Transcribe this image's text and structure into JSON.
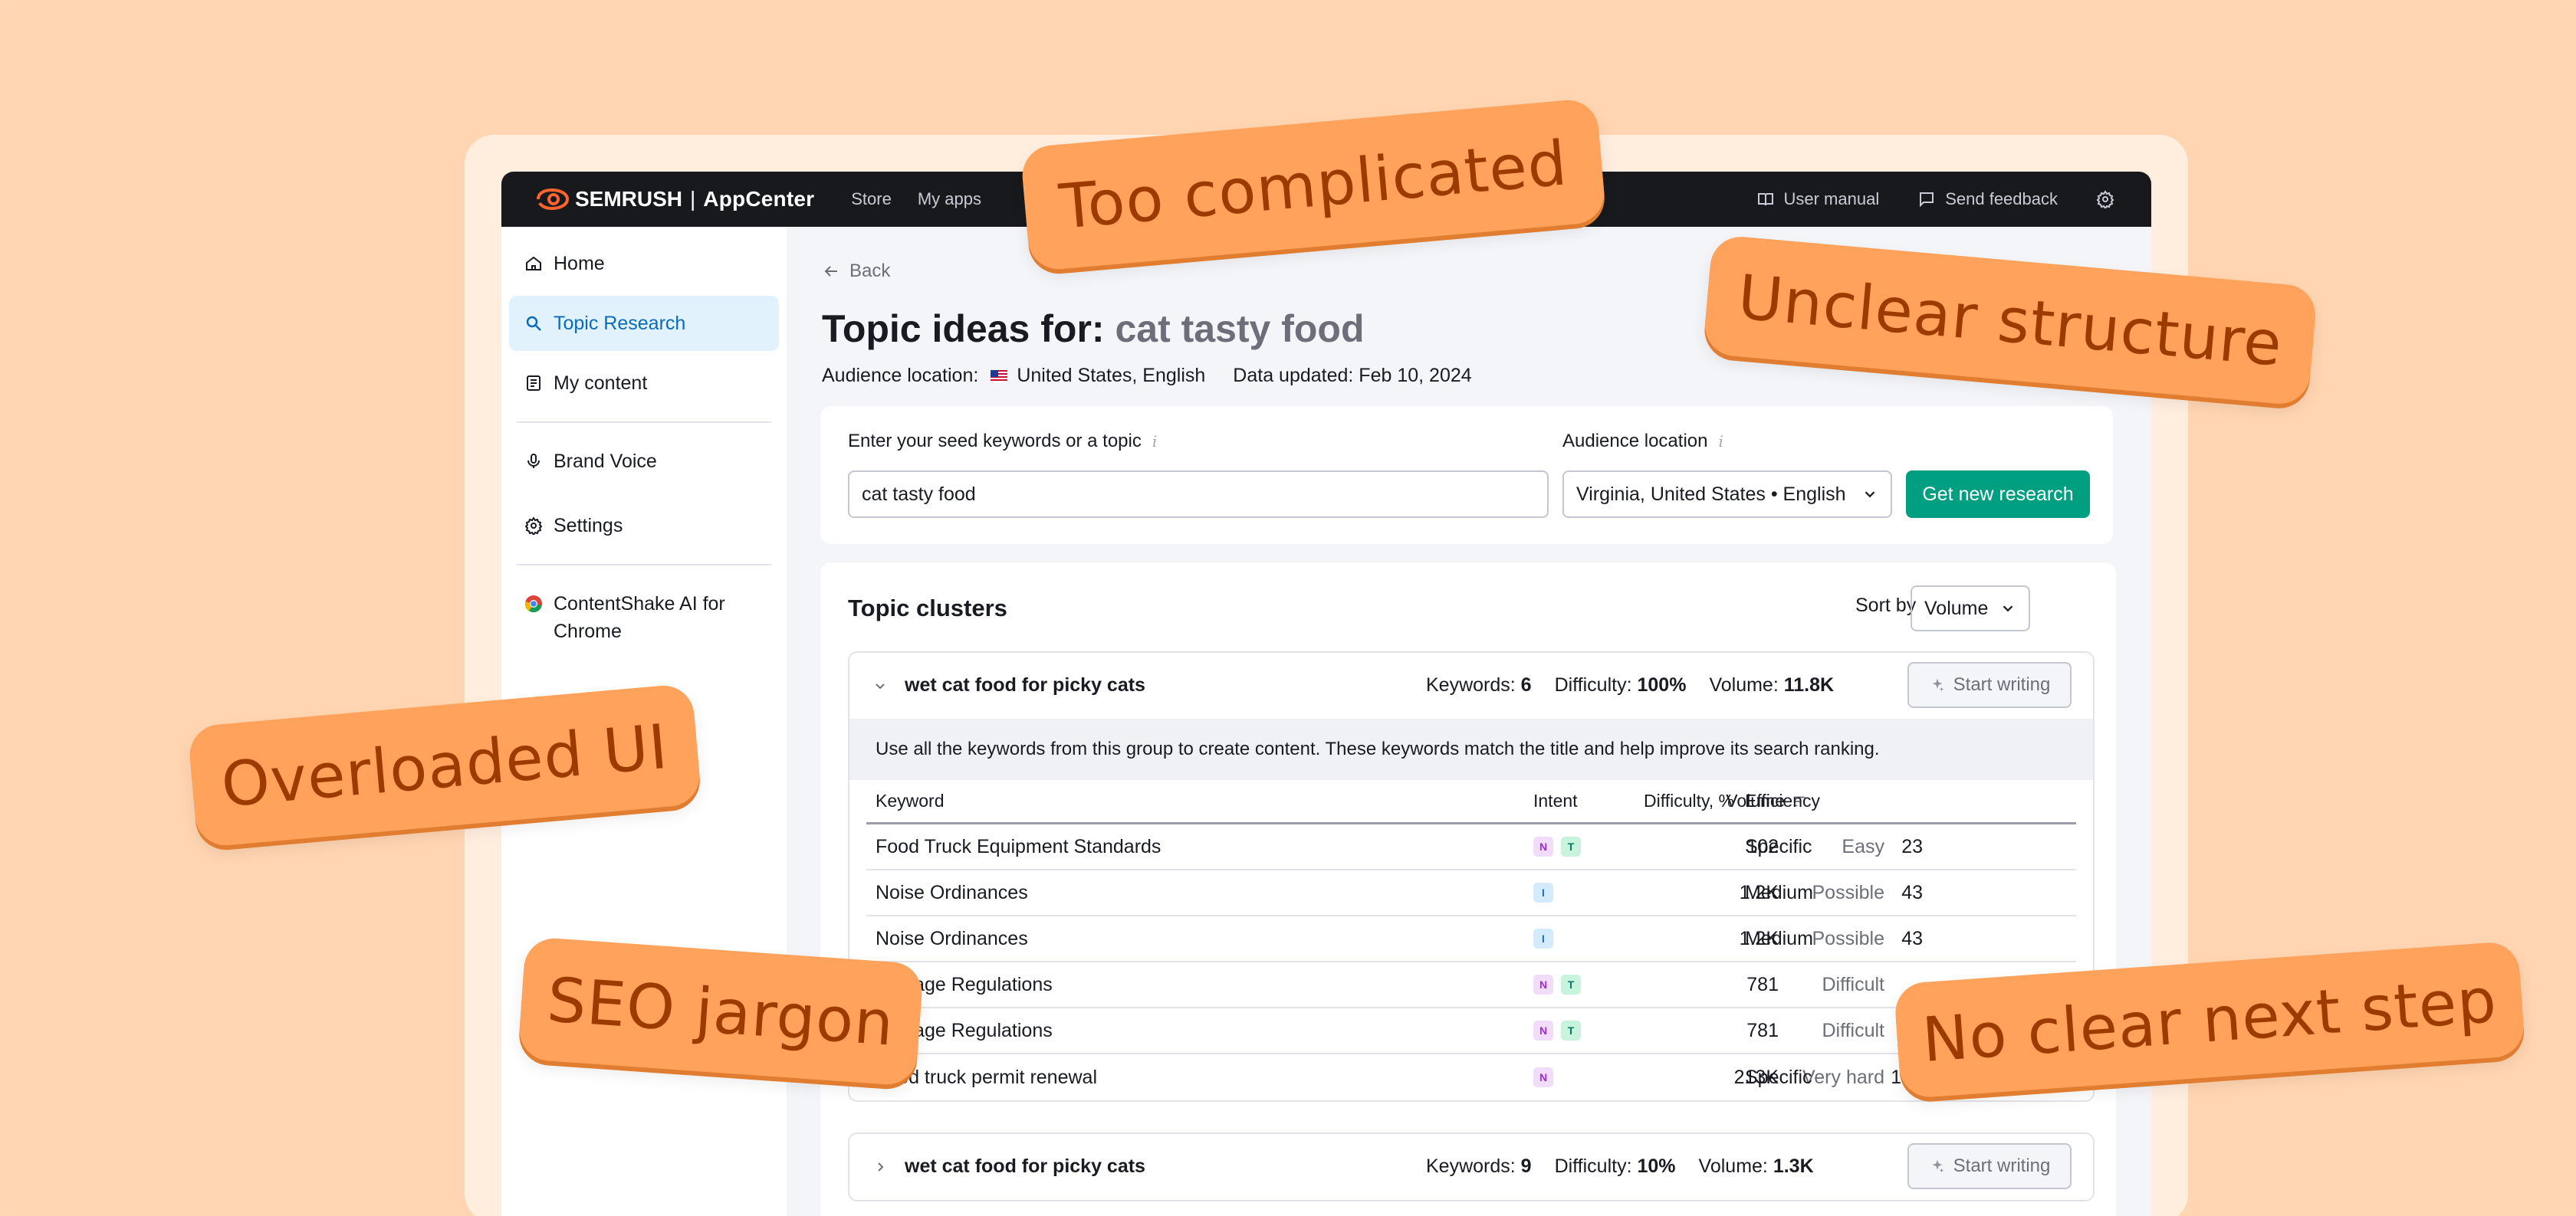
{
  "topbar": {
    "brand": "SEMRUSH",
    "brand_sep": "|",
    "app_name": "AppCenter",
    "nav": [
      "Store",
      "My apps"
    ],
    "user_manual": "User manual",
    "send_feedback": "Send feedback"
  },
  "sidebar": {
    "items": [
      {
        "label": "Home",
        "icon": "home-icon"
      },
      {
        "label": "Topic Research",
        "icon": "search-icon",
        "active": true
      },
      {
        "label": "My content",
        "icon": "document-icon"
      },
      {
        "label": "Brand Voice",
        "icon": "microphone-icon"
      },
      {
        "label": "Settings",
        "icon": "gear-icon"
      },
      {
        "label": "ContentShake AI for Chrome",
        "icon": "chrome-icon"
      }
    ]
  },
  "main": {
    "back": "Back",
    "title_prefix": "Topic ideas for:",
    "title_keyword": "cat tasty food",
    "audience_label": "Audience location:",
    "audience_value": "United States, English",
    "data_updated": "Data updated: Feb 10, 2024"
  },
  "search": {
    "seed_label": "Enter your seed keywords or a topic",
    "seed_value": "cat tasty food",
    "location_label": "Audience location",
    "location_value": "Virginia, United States • English",
    "submit": "Get new research",
    "info_glyph": "i"
  },
  "clusters": {
    "title": "Topic clusters",
    "sort_label": "Sort by",
    "sort_value": "Volume",
    "columns": {
      "keyword": "Keyword",
      "intent": "Intent",
      "volume": "Volume",
      "difficulty": "Difficulty, %",
      "efficiency": "Efficiency"
    },
    "items": [
      {
        "title": "wet cat food for picky cats",
        "keywords_label": "Keywords:",
        "keywords": "6",
        "difficulty_label": "Difficulty:",
        "difficulty": "100%",
        "volume_label": "Volume:",
        "volume": "11.8K",
        "action": "Start writing",
        "description": "Use all the keywords from this group to create content. These keywords match the title and help improve its search ranking.",
        "rows": [
          {
            "keyword": "Food Truck Equipment Standards",
            "intent": [
              "N",
              "T"
            ],
            "volume": "102",
            "difficulty_text": "Easy",
            "difficulty": "23",
            "efficiency": "Specific"
          },
          {
            "keyword": "Noise Ordinances",
            "intent": [
              "I"
            ],
            "volume": "1.2K",
            "difficulty_text": "Possible",
            "difficulty": "43",
            "efficiency": "Medium"
          },
          {
            "keyword": "Noise Ordinances",
            "intent": [
              "I"
            ],
            "volume": "1.2K",
            "difficulty_text": "Possible",
            "difficulty": "43",
            "efficiency": "Medium"
          },
          {
            "keyword": "Signage Regulations",
            "intent": [
              "N",
              "T"
            ],
            "volume": "781",
            "difficulty_text": "Difficult",
            "difficulty": "",
            "efficiency": ""
          },
          {
            "keyword": "Signage Regulations",
            "intent": [
              "N",
              "T"
            ],
            "volume": "781",
            "difficulty_text": "Difficult",
            "difficulty": "",
            "efficiency": ""
          },
          {
            "keyword": "Food truck permit renewal",
            "intent": [
              "N"
            ],
            "volume": "213K",
            "difficulty_text": "Very hard",
            "difficulty": "100",
            "efficiency": "Specific"
          }
        ]
      },
      {
        "title": "wet cat food for picky cats",
        "keywords_label": "Keywords:",
        "keywords": "9",
        "difficulty_label": "Difficulty:",
        "difficulty": "10%",
        "volume_label": "Volume:",
        "volume": "1.3K",
        "action": "Start writing"
      }
    ]
  },
  "stickers": [
    {
      "text": "Too complicated"
    },
    {
      "text": "Unclear structure"
    },
    {
      "text": "Overloaded UI"
    },
    {
      "text": "SEO jargon"
    },
    {
      "text": "No clear next step"
    }
  ],
  "colors": {
    "background": "#ffd5b2",
    "sticker": "#ffa35c",
    "sticker_text": "#9c3a00",
    "accent": "#009f81",
    "active_nav": "#0a6bb8",
    "topbar": "#18191d"
  }
}
